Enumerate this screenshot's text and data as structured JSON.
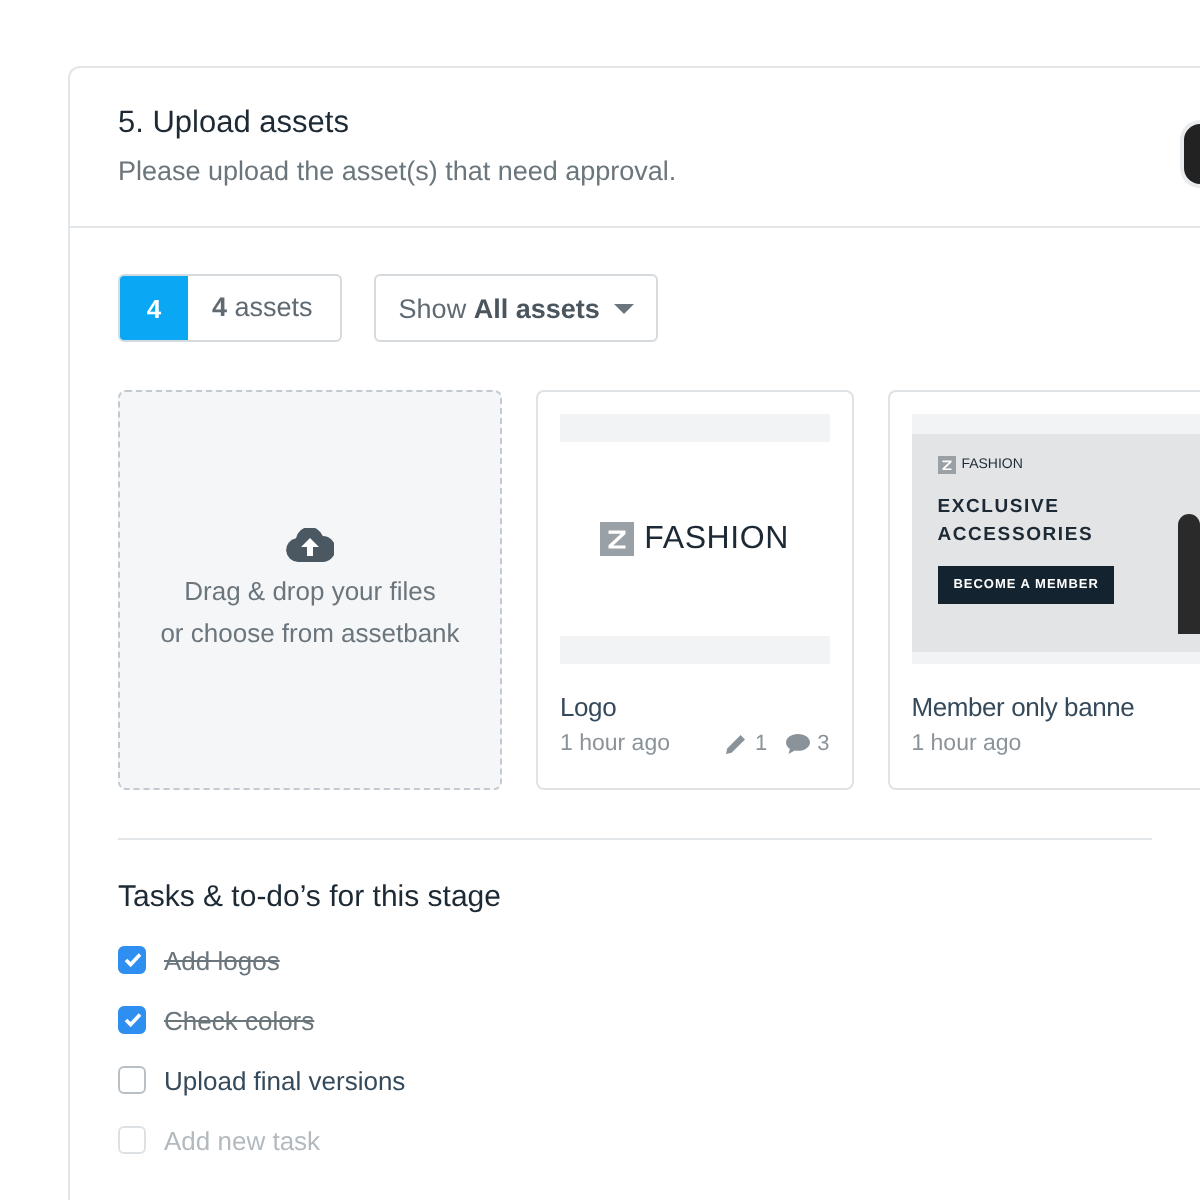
{
  "step": {
    "title": "5. Upload assets",
    "subtitle": "Please upload the asset(s) that need approval."
  },
  "asset_count": {
    "badge": "4",
    "label": "**4** assets"
  },
  "filter": {
    "label": "Show **All assets**"
  },
  "dropzone": {
    "line_1": "Drag & drop your files",
    "line_2": "or choose from assetbank"
  },
  "assets": [
    {
      "kind": "logo",
      "logo_text": "FASHION",
      "name": "Logo",
      "time": "1 hour ago",
      "edits": "1",
      "comments": "3"
    },
    {
      "kind": "banner",
      "brand": "FASHION",
      "headline": "EXCLUSIVE ACCESSORIES",
      "cta": "BECOME A MEMBER",
      "name": "Member only banne",
      "time": "1 hour ago"
    }
  ],
  "tasks": {
    "title": "Tasks & to-do’s for this stage",
    "items": [
      {
        "label": "Add logos",
        "checked": true,
        "disabled": false
      },
      {
        "label": "Check colors",
        "checked": true,
        "disabled": false
      },
      {
        "label": "Upload final versions",
        "checked": false,
        "disabled": false
      },
      {
        "label": "Add new task",
        "checked": false,
        "disabled": true
      }
    ]
  }
}
